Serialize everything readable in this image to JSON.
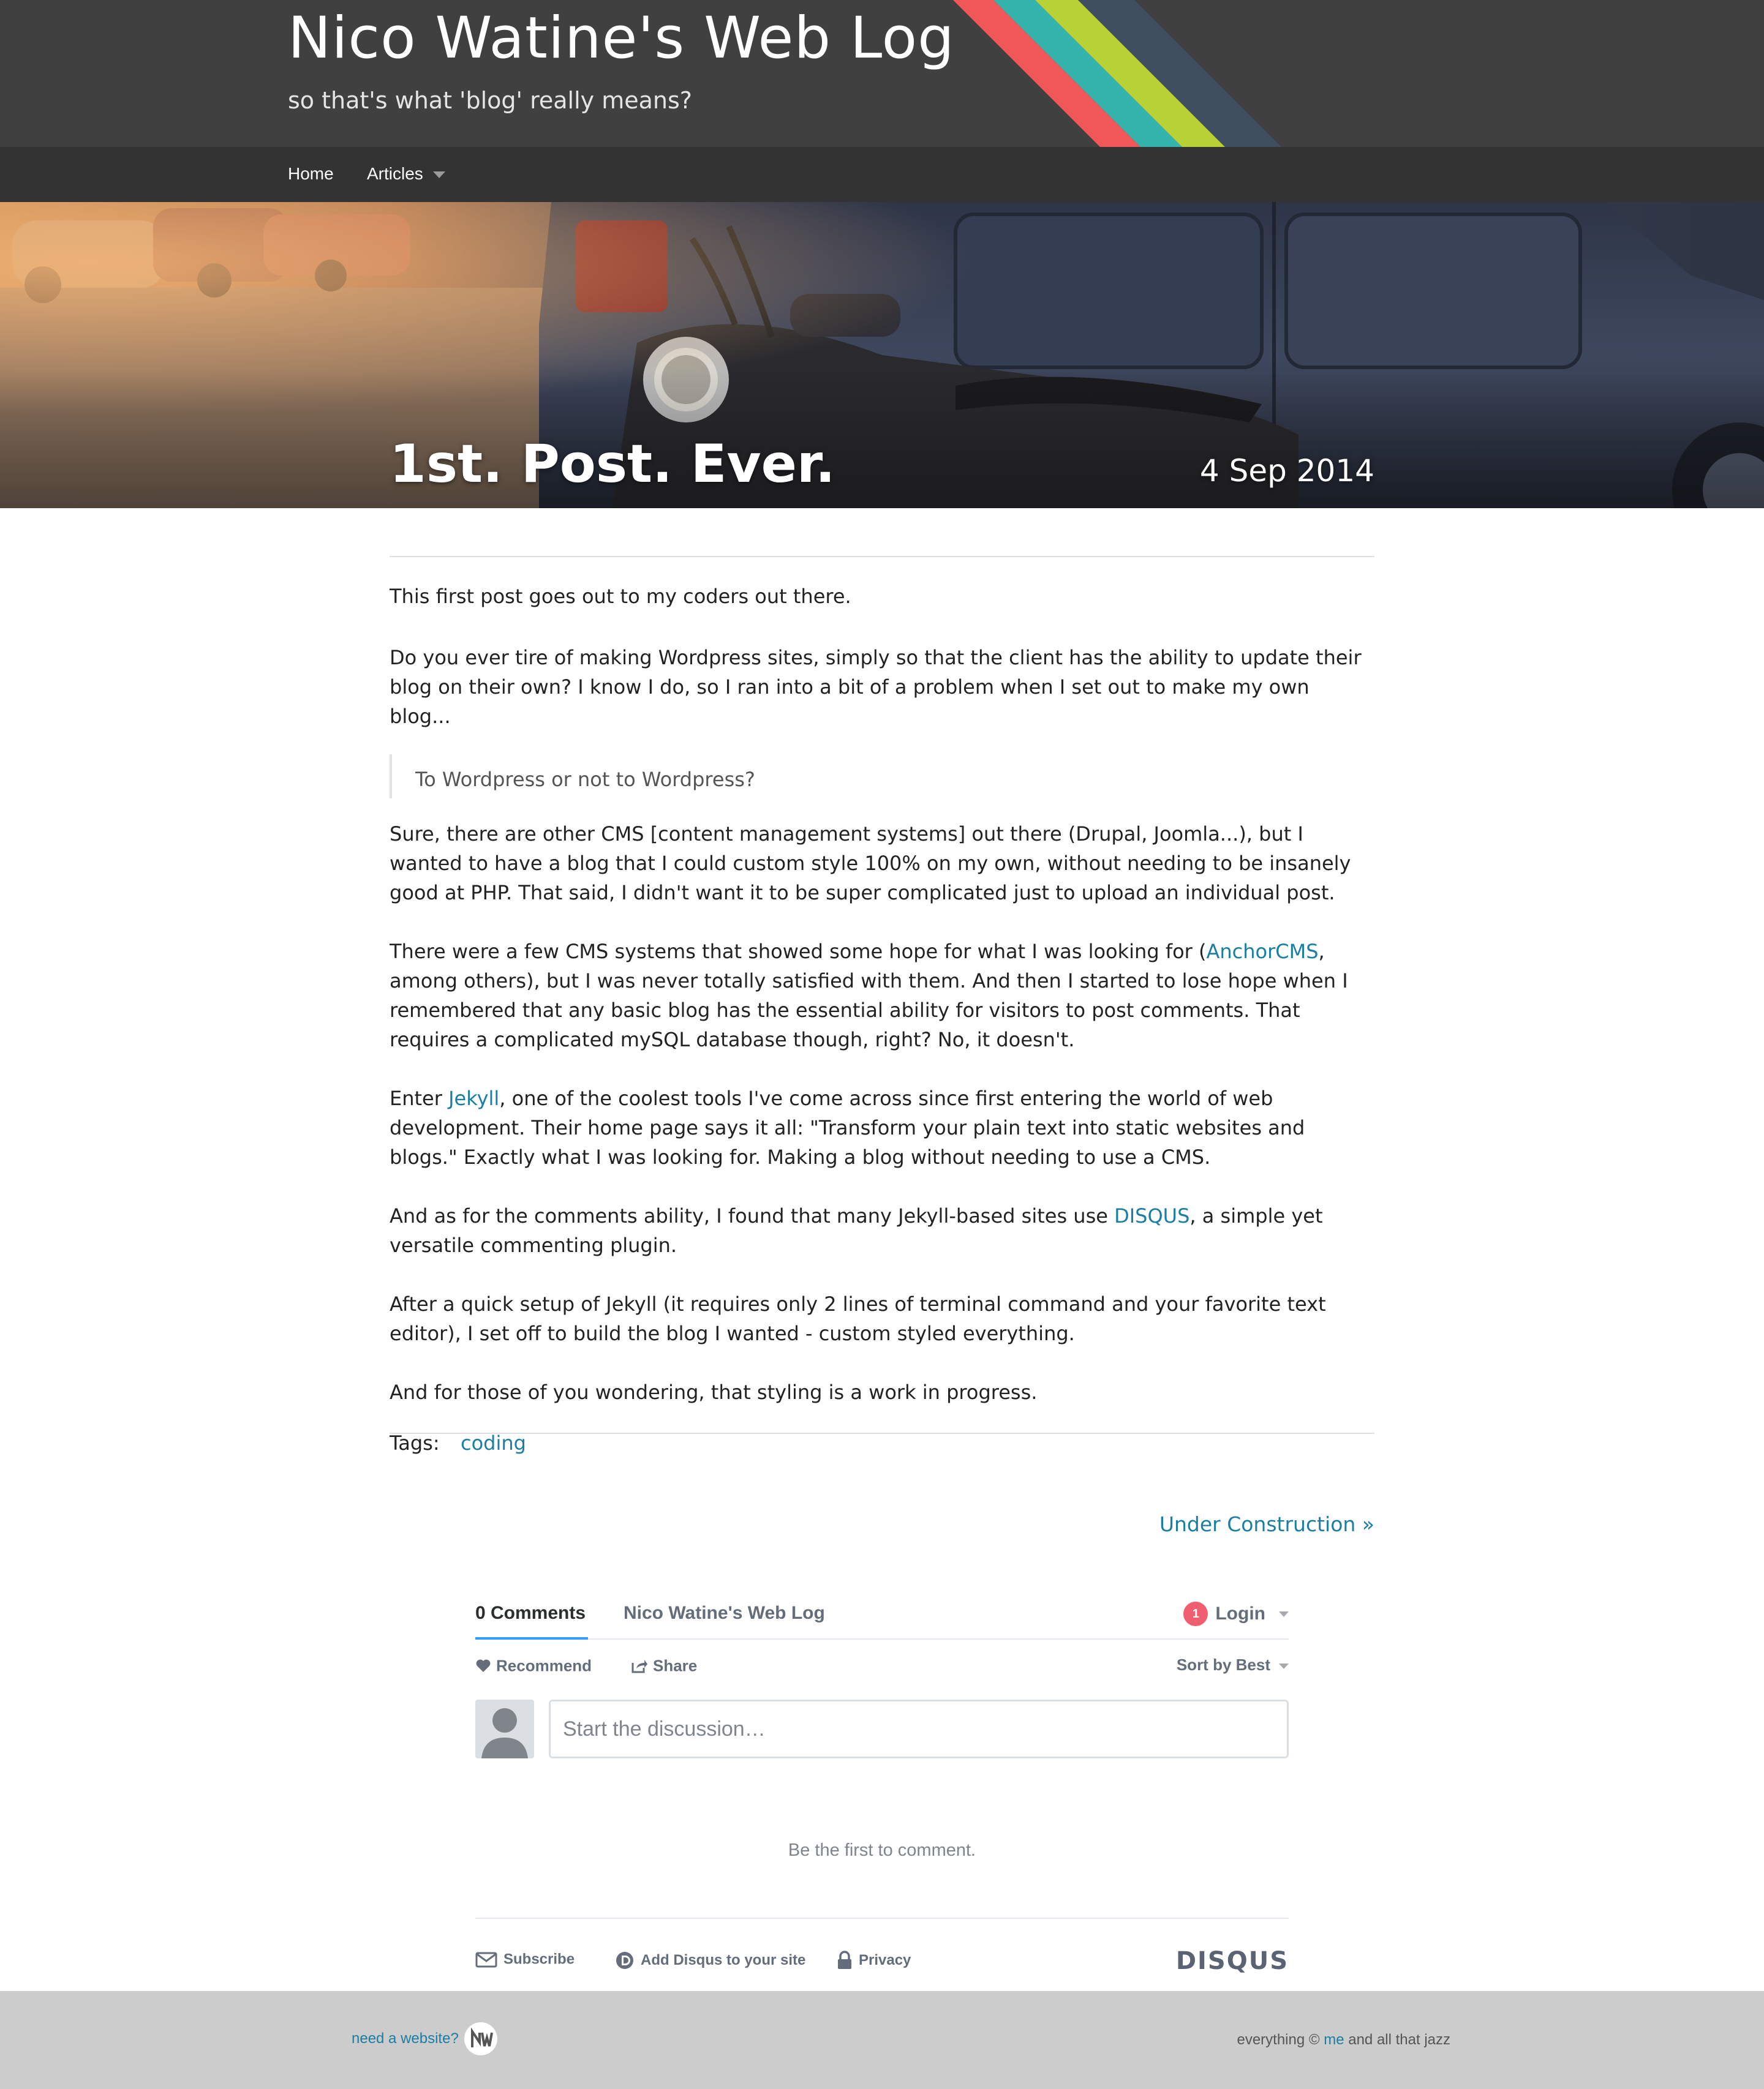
{
  "header": {
    "title": "Nico Watine's Web Log",
    "tagline": "so that's what 'blog' really means?",
    "stripe_colors": [
      "#ef5758",
      "#35b3ad",
      "#b9d336",
      "#3f4f5f"
    ]
  },
  "nav": {
    "items": [
      {
        "label": "Home"
      },
      {
        "label": "Articles",
        "has_dropdown": true
      }
    ]
  },
  "post": {
    "title": "1st. Post. Ever.",
    "date": "4 Sep 2014",
    "hero_image": "motorcycle-parked-next-to-suv",
    "p1": "This first post goes out to my coders out there.",
    "p2": "Do you ever tire of making Wordpress sites, simply so that the client has the ability to update their blog on their own? I know I do, so I ran into a bit of a problem when I set out to make my own blog...",
    "quote": "To Wordpress or not to Wordpress?",
    "p3": "Sure, there are other CMS [content management systems] out there (Drupal, Joomla...), but I wanted to have a blog that I could custom style 100% on my own, without needing to be insanely good at PHP. That said, I didn't want it to be super complicated just to upload an individual post.",
    "p4_before": "There were a few CMS systems that showed some hope for what I was looking for (",
    "p4_link": "AnchorCMS",
    "p4_after": ", among others), but I was never totally satisfied with them. And then I started to lose hope when I remembered that any basic blog has the essential ability for visitors to post comments. That requires a complicated mySQL database though, right? No, it doesn't.",
    "p5_before": "Enter ",
    "p5_link": "Jekyll",
    "p5_after": ", one of the coolest tools I've come across since first entering the world of web development. Their home page says it all: \"Transform your plain text into static websites and blogs.\" Exactly what I was looking for. Making a blog without needing to use a CMS.",
    "p6_before": "And as for the comments ability, I found that many Jekyll-based sites use ",
    "p6_link": "DISQUS",
    "p6_after": ", a simple yet versatile commenting plugin.",
    "p7": "After a quick setup of Jekyll (it requires only 2 lines of terminal command and your favorite text editor), I set off to build the blog I wanted - custom styled everything.",
    "p8": "And for those of you wondering, that styling is a work in progress.",
    "tags_label": "Tags:",
    "tags": [
      "coding"
    ],
    "next_link": "Under Construction »",
    "link_color": "#1b7ea3"
  },
  "disqus": {
    "tab_comments": "0 Comments",
    "tab_site": "Nico Watine's Web Log",
    "notification_count": "1",
    "login_label": "Login",
    "recommend_label": "Recommend",
    "share_label": "Share",
    "sort_label": "Sort by Best",
    "input_placeholder": "Start the discussion…",
    "empty_message": "Be the first to comment.",
    "subscribe_label": "Subscribe",
    "add_disqus_label": "Add Disqus to your site",
    "privacy_label": "Privacy",
    "logo_text": "DISQUS",
    "accent": "#2e9fff"
  },
  "footer": {
    "left_link": "need a website?",
    "right_before": "everything © ",
    "right_link": "me",
    "right_after": " and all that jazz"
  }
}
